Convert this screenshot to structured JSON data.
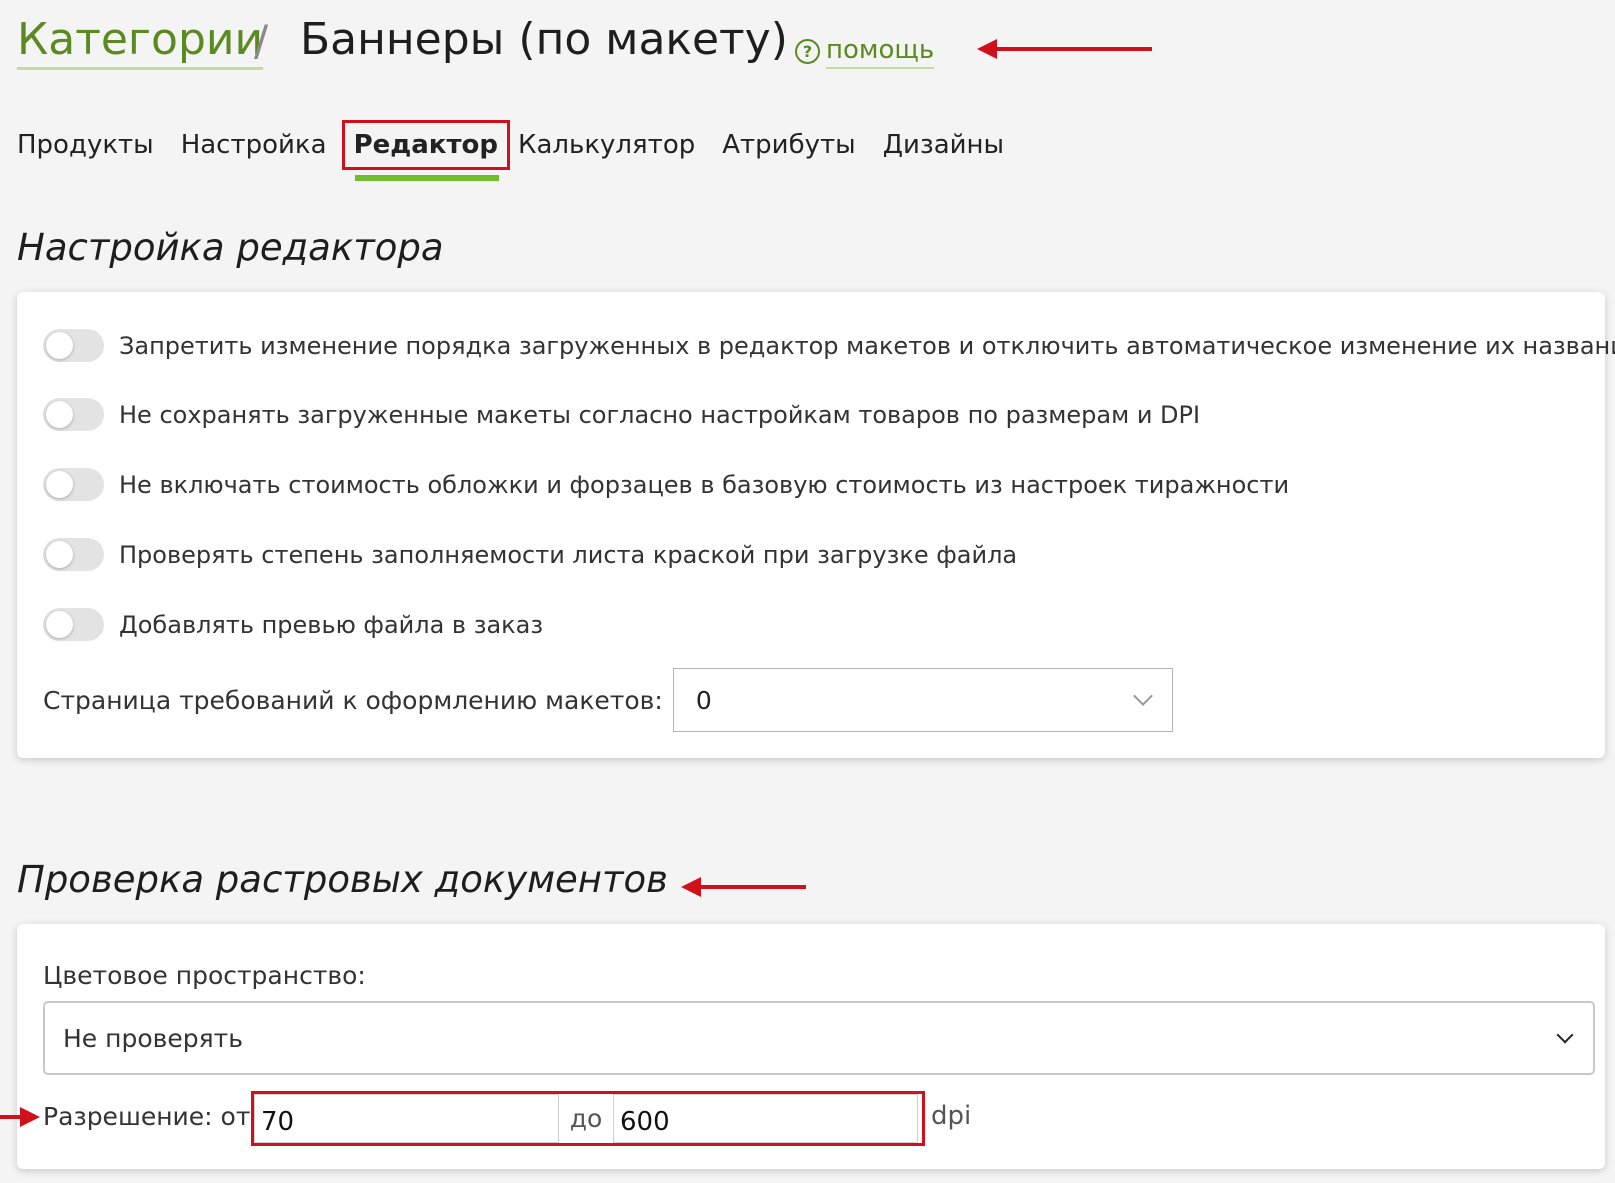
{
  "header": {
    "breadcrumb_root": "Категории",
    "separator": "/",
    "current": "Баннеры (по макету)",
    "help_icon_glyph": "?",
    "help_label": "помощь"
  },
  "tabs": [
    {
      "label": "Продукты",
      "active": false
    },
    {
      "label": "Настройка",
      "active": false
    },
    {
      "label": "Редактор",
      "active": true
    },
    {
      "label": "Калькулятор",
      "active": false
    },
    {
      "label": "Атрибуты",
      "active": false
    },
    {
      "label": "Дизайны",
      "active": false
    }
  ],
  "editor_settings": {
    "title": "Настройка редактора",
    "toggles": [
      {
        "label": "Запретить изменение порядка загруженных в редактор макетов и отключить автоматическое изменение их названий",
        "on": false
      },
      {
        "label": "Не сохранять загруженные макеты согласно настройкам товаров по размерам и DPI",
        "on": false
      },
      {
        "label": "Не включать стоимость обложки и форзацев в базовую стоимость из настроек тиражности",
        "on": false
      },
      {
        "label": "Проверять степень заполняемости листа краской при загрузке файла",
        "on": false
      },
      {
        "label": "Добавлять превью файла в заказ",
        "on": false
      }
    ],
    "requirements_page": {
      "label": "Страница требований к оформлению макетов:",
      "value": "0"
    }
  },
  "raster_check": {
    "title": "Проверка растровых документов",
    "color_space": {
      "label": "Цветовое пространство:",
      "value": "Не проверять"
    },
    "resolution": {
      "label": "Разрешение: от",
      "from": "70",
      "middle": "до",
      "to": "600",
      "unit": "dpi"
    }
  },
  "colors": {
    "accent_green": "#72bd2f",
    "link_green": "#5b8a21",
    "annotation_red": "#d0111b"
  },
  "icons": {
    "help": "question-circle-icon",
    "dropdown": "chevron-down-icon",
    "annotation": "red-arrow-icon"
  }
}
